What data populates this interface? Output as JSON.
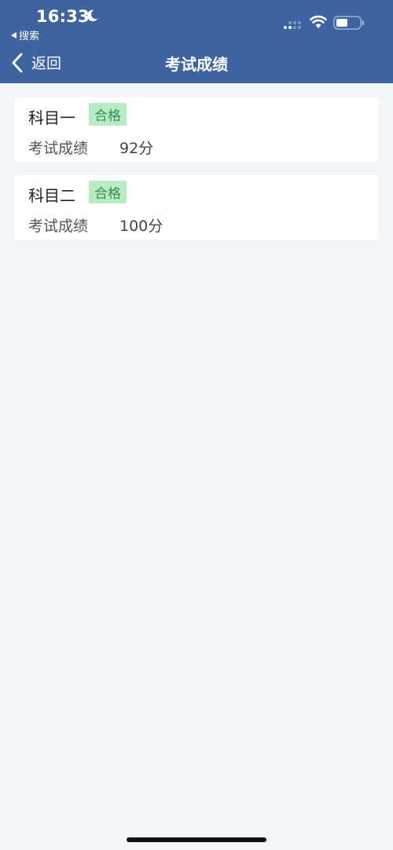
{
  "status_bar": {
    "time": "16:33",
    "back_app_label": "搜索"
  },
  "nav": {
    "back_label": "返回",
    "title": "考试成绩"
  },
  "results": [
    {
      "subject": "科目一",
      "badge": "合格",
      "score_label": "考试成绩",
      "score": "92分"
    },
    {
      "subject": "科目二",
      "badge": "合格",
      "score_label": "考试成绩",
      "score": "100分"
    }
  ],
  "colors": {
    "header_bg": "#3d64a0",
    "page_bg": "#f2f6f8",
    "badge_bg": "#b8ecc4",
    "badge_text": "#3a8a4e"
  },
  "icons": [
    "moon-icon",
    "signal-icon",
    "wifi-icon",
    "battery-icon",
    "chevron-left-icon"
  ]
}
